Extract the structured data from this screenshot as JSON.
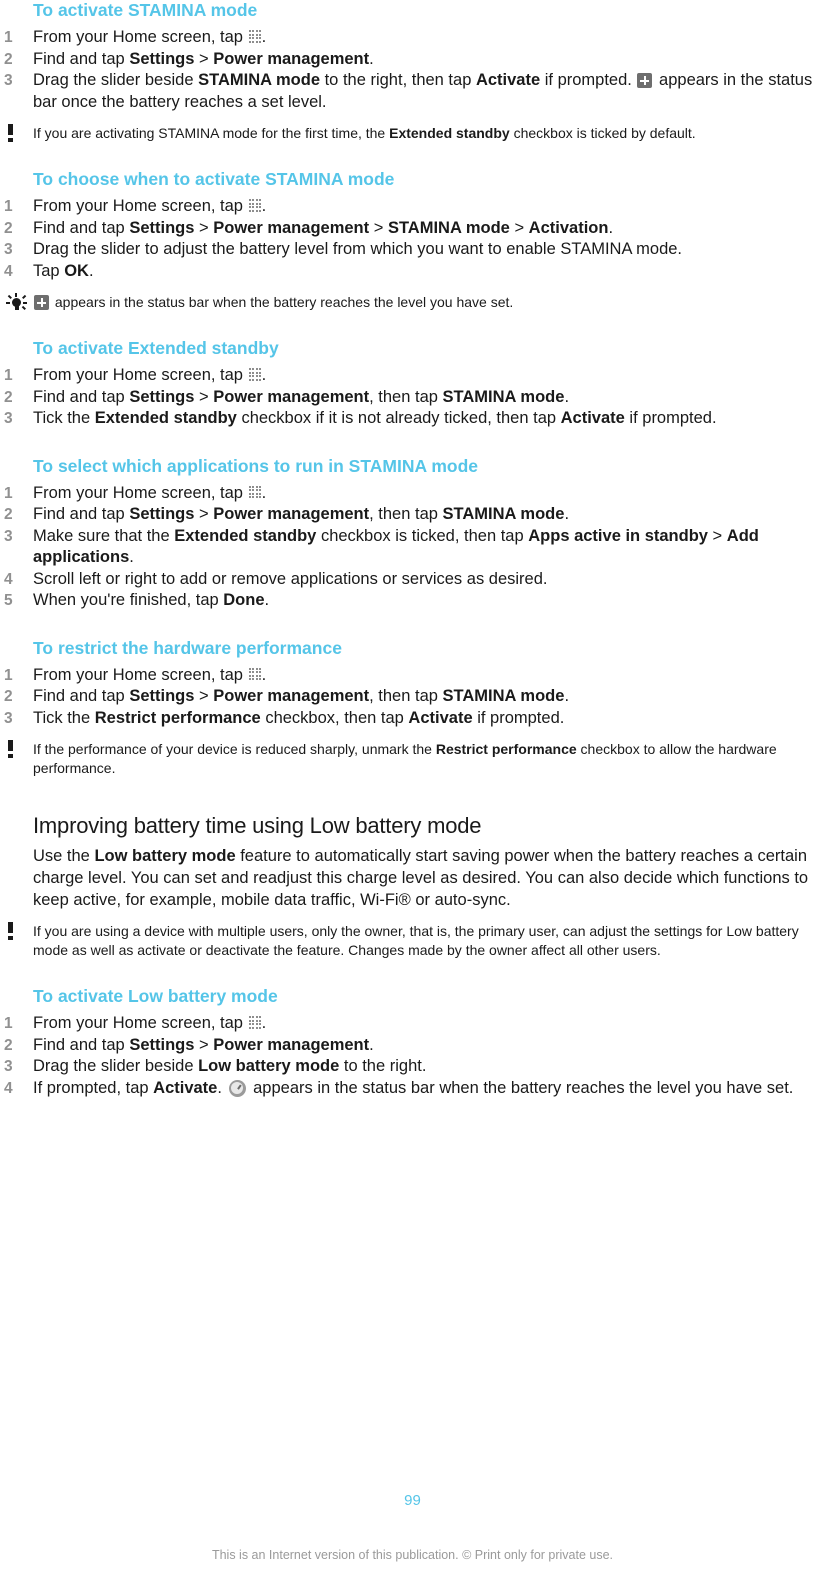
{
  "document": {
    "page_number": "99",
    "footer_note": "This is an Internet version of this publication. © Print only for private use.",
    "accent_color": "#55c5e8",
    "text_color": "#1a1a1a",
    "number_color": "#909090"
  },
  "icons": {
    "app_drawer": "app-drawer-icon",
    "battery_plus": "battery-plus-status-icon",
    "low_battery_gauge": "low-battery-gauge-icon",
    "warning": "warning-exclamation-icon",
    "tip": "tip-lightbulb-icon"
  },
  "sections": [
    {
      "id": "activate-stamina-mode",
      "heading": "To activate STAMINA mode",
      "steps": [
        {
          "number": "1",
          "parts": [
            {
              "t": "From your Home screen, tap ",
              "b": false
            },
            {
              "t": "",
              "icon": "app-drawer"
            },
            {
              "t": ".",
              "b": false
            }
          ]
        },
        {
          "number": "2",
          "parts": [
            {
              "t": "Find and tap ",
              "b": false
            },
            {
              "t": "Settings",
              "b": true
            },
            {
              "t": " > ",
              "b": false
            },
            {
              "t": "Power management",
              "b": true
            },
            {
              "t": ".",
              "b": false
            }
          ]
        },
        {
          "number": "3",
          "parts": [
            {
              "t": "Drag the slider beside ",
              "b": false
            },
            {
              "t": "STAMINA mode",
              "b": true
            },
            {
              "t": " to the right, then tap ",
              "b": false
            },
            {
              "t": "Activate",
              "b": true
            },
            {
              "t": " if prompted. ",
              "b": false
            },
            {
              "t": "",
              "icon": "battery-plus"
            },
            {
              "t": " appears in the status bar once the battery reaches a set level.",
              "b": false
            }
          ]
        }
      ],
      "note": {
        "type": "warning",
        "parts": [
          {
            "t": "If you are activating STAMINA mode for the first time, the ",
            "b": false
          },
          {
            "t": "Extended standby",
            "b": true
          },
          {
            "t": " checkbox is ticked by default.",
            "b": false
          }
        ]
      }
    },
    {
      "id": "choose-when-to-activate-stamina-mode",
      "heading": "To choose when to activate STAMINA mode",
      "steps": [
        {
          "number": "1",
          "parts": [
            {
              "t": "From your Home screen, tap ",
              "b": false
            },
            {
              "t": "",
              "icon": "app-drawer"
            },
            {
              "t": ".",
              "b": false
            }
          ]
        },
        {
          "number": "2",
          "parts": [
            {
              "t": "Find and tap ",
              "b": false
            },
            {
              "t": "Settings",
              "b": true
            },
            {
              "t": " > ",
              "b": false
            },
            {
              "t": "Power management",
              "b": true
            },
            {
              "t": " > ",
              "b": false
            },
            {
              "t": "STAMINA mode",
              "b": true
            },
            {
              "t": " > ",
              "b": false
            },
            {
              "t": "Activation",
              "b": true
            },
            {
              "t": ".",
              "b": false
            }
          ]
        },
        {
          "number": "3",
          "parts": [
            {
              "t": "Drag the slider to adjust the battery level from which you want to enable STAMINA mode.",
              "b": false
            }
          ]
        },
        {
          "number": "4",
          "parts": [
            {
              "t": "Tap ",
              "b": false
            },
            {
              "t": "OK",
              "b": true
            },
            {
              "t": ".",
              "b": false
            }
          ]
        }
      ],
      "note": {
        "type": "tip",
        "parts": [
          {
            "t": "",
            "icon": "battery-plus"
          },
          {
            "t": " appears in the status bar when the battery reaches the level you have set.",
            "b": false
          }
        ]
      }
    },
    {
      "id": "activate-extended-standby",
      "heading": "To activate Extended standby",
      "steps": [
        {
          "number": "1",
          "parts": [
            {
              "t": "From your Home screen, tap ",
              "b": false
            },
            {
              "t": "",
              "icon": "app-drawer"
            },
            {
              "t": ".",
              "b": false
            }
          ]
        },
        {
          "number": "2",
          "parts": [
            {
              "t": "Find and tap ",
              "b": false
            },
            {
              "t": "Settings",
              "b": true
            },
            {
              "t": " > ",
              "b": false
            },
            {
              "t": "Power management",
              "b": true
            },
            {
              "t": ", then tap ",
              "b": false
            },
            {
              "t": "STAMINA mode",
              "b": true
            },
            {
              "t": ".",
              "b": false
            }
          ]
        },
        {
          "number": "3",
          "parts": [
            {
              "t": "Tick the ",
              "b": false
            },
            {
              "t": "Extended standby",
              "b": true
            },
            {
              "t": " checkbox if it is not already ticked, then tap ",
              "b": false
            },
            {
              "t": "Activate",
              "b": true
            },
            {
              "t": " if prompted.",
              "b": false
            }
          ]
        }
      ],
      "note": null
    },
    {
      "id": "select-applications-to-run-in-stamina-mode",
      "heading": "To select which applications to run in STAMINA mode",
      "steps": [
        {
          "number": "1",
          "parts": [
            {
              "t": "From your Home screen, tap ",
              "b": false
            },
            {
              "t": "",
              "icon": "app-drawer"
            },
            {
              "t": ".",
              "b": false
            }
          ]
        },
        {
          "number": "2",
          "parts": [
            {
              "t": "Find and tap ",
              "b": false
            },
            {
              "t": "Settings",
              "b": true
            },
            {
              "t": " > ",
              "b": false
            },
            {
              "t": "Power management",
              "b": true
            },
            {
              "t": ", then tap ",
              "b": false
            },
            {
              "t": "STAMINA mode",
              "b": true
            },
            {
              "t": ".",
              "b": false
            }
          ]
        },
        {
          "number": "3",
          "parts": [
            {
              "t": "Make sure that the ",
              "b": false
            },
            {
              "t": "Extended standby",
              "b": true
            },
            {
              "t": " checkbox is ticked, then tap ",
              "b": false
            },
            {
              "t": "Apps active in standby",
              "b": true
            },
            {
              "t": " > ",
              "b": false
            },
            {
              "t": "Add applications",
              "b": true
            },
            {
              "t": ".",
              "b": false
            }
          ]
        },
        {
          "number": "4",
          "parts": [
            {
              "t": "Scroll left or right to add or remove applications or services as desired.",
              "b": false
            }
          ]
        },
        {
          "number": "5",
          "parts": [
            {
              "t": "When you're finished, tap ",
              "b": false
            },
            {
              "t": "Done",
              "b": true
            },
            {
              "t": ".",
              "b": false
            }
          ]
        }
      ],
      "note": null
    },
    {
      "id": "restrict-the-hardware-performance",
      "heading": "To restrict the hardware performance",
      "steps": [
        {
          "number": "1",
          "parts": [
            {
              "t": "From your Home screen, tap ",
              "b": false
            },
            {
              "t": "",
              "icon": "app-drawer"
            },
            {
              "t": ".",
              "b": false
            }
          ]
        },
        {
          "number": "2",
          "parts": [
            {
              "t": "Find and tap ",
              "b": false
            },
            {
              "t": "Settings",
              "b": true
            },
            {
              "t": " > ",
              "b": false
            },
            {
              "t": "Power management",
              "b": true
            },
            {
              "t": ", then tap ",
              "b": false
            },
            {
              "t": "STAMINA mode",
              "b": true
            },
            {
              "t": ".",
              "b": false
            }
          ]
        },
        {
          "number": "3",
          "parts": [
            {
              "t": "Tick the ",
              "b": false
            },
            {
              "t": "Restrict performance",
              "b": true
            },
            {
              "t": " checkbox, then tap ",
              "b": false
            },
            {
              "t": "Activate",
              "b": true
            },
            {
              "t": " if prompted.",
              "b": false
            }
          ]
        }
      ],
      "note": {
        "type": "warning",
        "parts": [
          {
            "t": "If the performance of your device is reduced sharply, unmark the ",
            "b": false
          },
          {
            "t": "Restrict performance",
            "b": true
          },
          {
            "t": " checkbox to allow the hardware performance.",
            "b": false
          }
        ]
      }
    }
  ],
  "low_battery_section": {
    "heading": "Improving battery time using Low battery mode",
    "body": [
      {
        "t": "Use the ",
        "b": false
      },
      {
        "t": "Low battery mode",
        "b": true
      },
      {
        "t": " feature to automatically start saving power when the battery reaches a certain charge level. You can set and readjust this charge level as desired. You can also decide which functions to keep active, for example, mobile data traffic, Wi-Fi® or auto-sync.",
        "b": false
      }
    ],
    "note": {
      "type": "warning",
      "parts": [
        {
          "t": "If you are using a device with multiple users, only the owner, that is, the primary user, can adjust the settings for Low battery mode as well as activate or deactivate the feature. Changes made by the owner affect all other users.",
          "b": false
        }
      ]
    },
    "subsection": {
      "id": "activate-low-battery-mode",
      "heading": "To activate Low battery mode",
      "steps": [
        {
          "number": "1",
          "parts": [
            {
              "t": "From your Home screen, tap ",
              "b": false
            },
            {
              "t": "",
              "icon": "app-drawer"
            },
            {
              "t": ".",
              "b": false
            }
          ]
        },
        {
          "number": "2",
          "parts": [
            {
              "t": "Find and tap ",
              "b": false
            },
            {
              "t": "Settings",
              "b": true
            },
            {
              "t": " > ",
              "b": false
            },
            {
              "t": "Power management",
              "b": true
            },
            {
              "t": ".",
              "b": false
            }
          ]
        },
        {
          "number": "3",
          "parts": [
            {
              "t": "Drag the slider beside ",
              "b": false
            },
            {
              "t": "Low battery mode",
              "b": true
            },
            {
              "t": " to the right.",
              "b": false
            }
          ]
        },
        {
          "number": "4",
          "parts": [
            {
              "t": "If prompted, tap ",
              "b": false
            },
            {
              "t": "Activate",
              "b": true
            },
            {
              "t": ". ",
              "b": false
            },
            {
              "t": "",
              "icon": "gauge"
            },
            {
              "t": " appears in the status bar when the battery reaches the level you have set.",
              "b": false
            }
          ]
        }
      ]
    }
  }
}
